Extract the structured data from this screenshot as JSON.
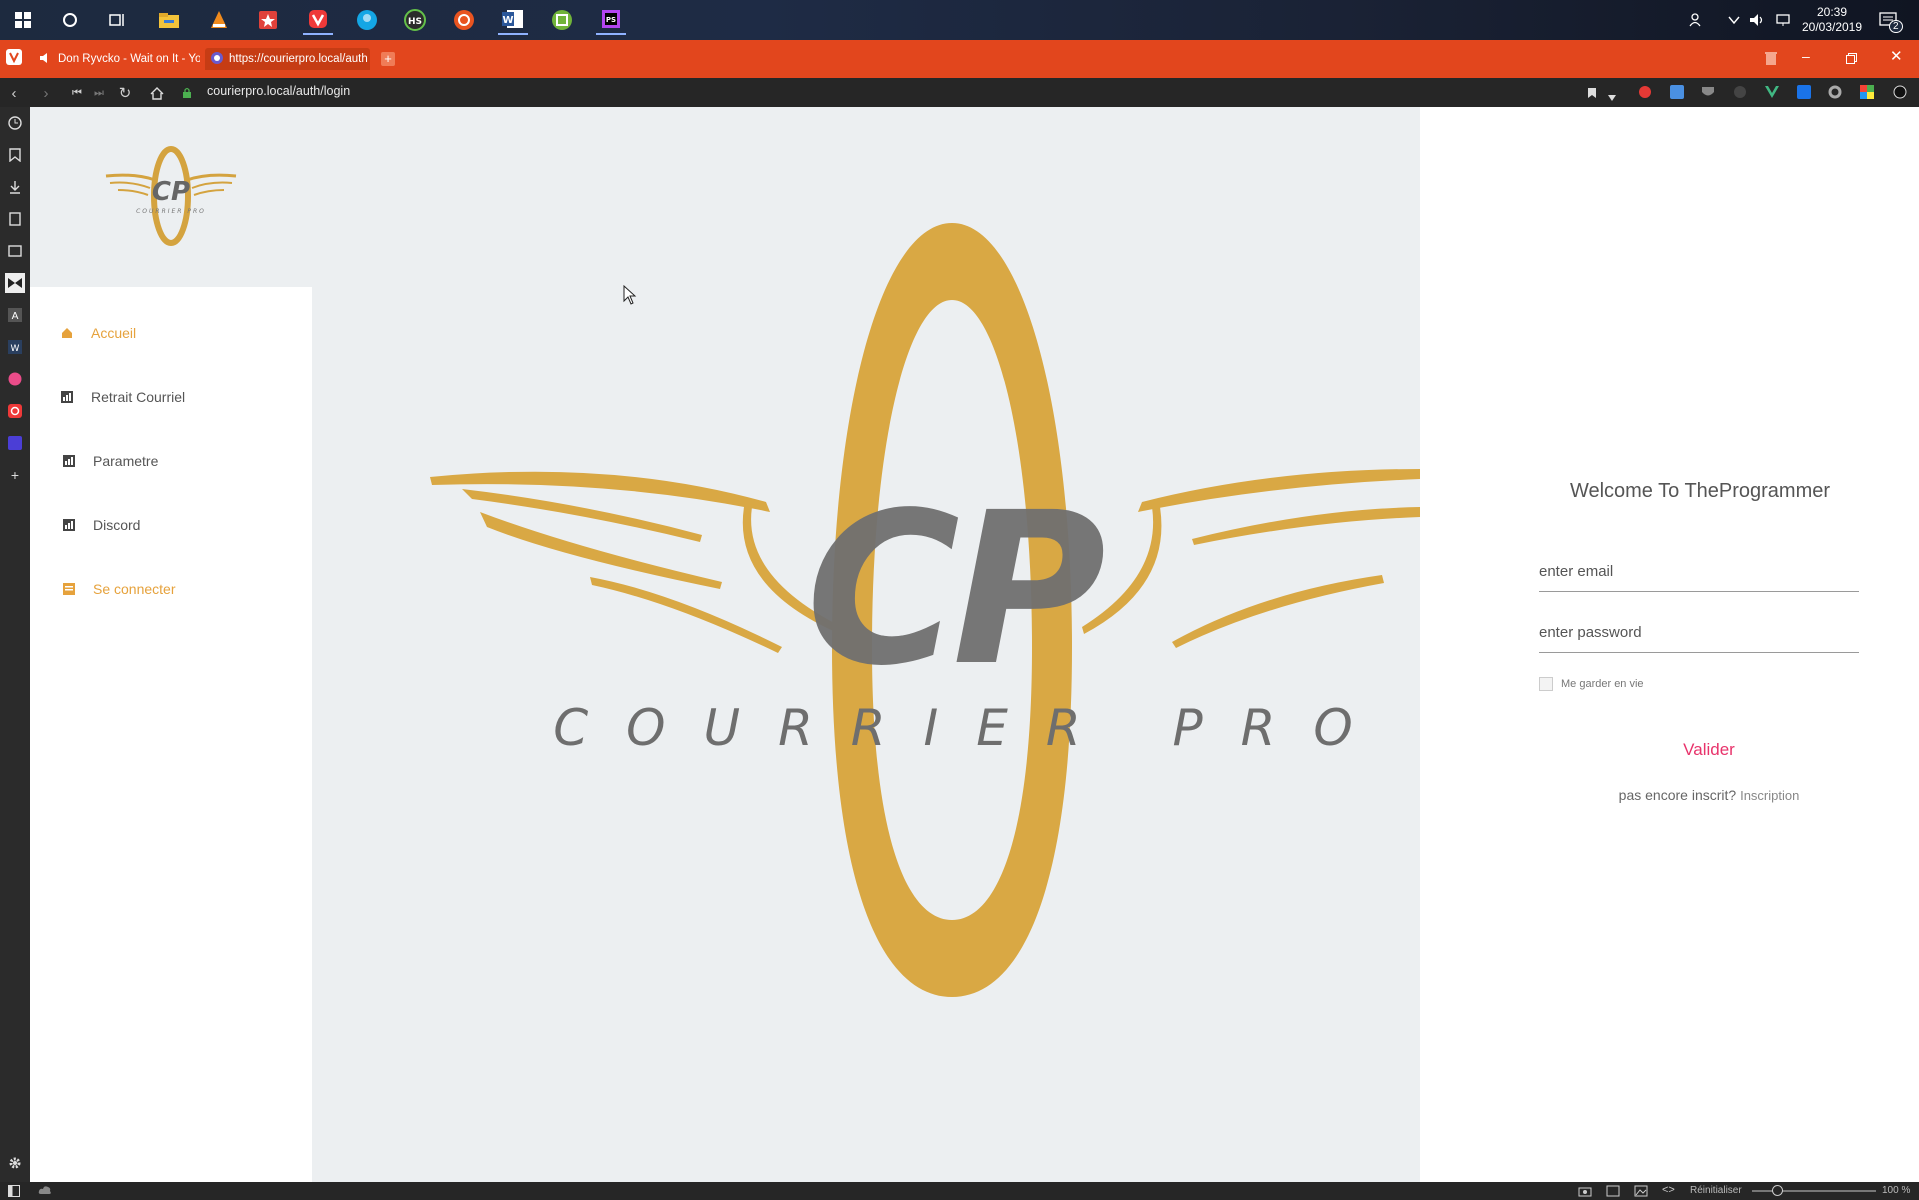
{
  "taskbar": {
    "clock_time": "20:39",
    "clock_date": "20/03/2019",
    "notification_count": "2",
    "apps": [
      "start-icon",
      "cortana-icon",
      "task-view-icon",
      "file-explorer-icon",
      "vlc-icon",
      "app-red-icon",
      "vivaldi-icon",
      "app-blue-icon",
      "hs-icon",
      "ubuntu-icon",
      "word-icon",
      "app-green-icon",
      "phpstorm-icon"
    ]
  },
  "browser": {
    "tabs": [
      {
        "label": "Don Ryvcko - Wait on It - Yo"
      },
      {
        "label": "https://courierpro.local/auth"
      }
    ],
    "url": "courierpro.local/auth/login",
    "status": {
      "reset_label": "Réinitialiser",
      "zoom": "100 %"
    }
  },
  "sidebar": {
    "logo_text": "CP",
    "logo_sub": "COURRIER PRO",
    "items": [
      {
        "label": "Accueil",
        "active": true
      },
      {
        "label": "Retrait Courriel",
        "active": false
      },
      {
        "label": "Parametre",
        "active": false
      },
      {
        "label": "Discord",
        "active": false
      },
      {
        "label": "Se connecter",
        "active": true
      }
    ]
  },
  "hero": {
    "logo_text": "CP",
    "logo_sub": "COURRIER PRO"
  },
  "login": {
    "title": "Welcome To TheProgrammer",
    "email_placeholder": "enter email",
    "password_placeholder": "enter password",
    "remember_label": "Me garder en vie",
    "submit_label": "Valider",
    "signup_prompt": "pas encore inscrit?",
    "signup_link": "Inscription"
  },
  "colors": {
    "accent": "#e6a23c",
    "gold": "#d4a33f",
    "submit": "#e8336b",
    "vivaldi_red": "#e2461d"
  }
}
